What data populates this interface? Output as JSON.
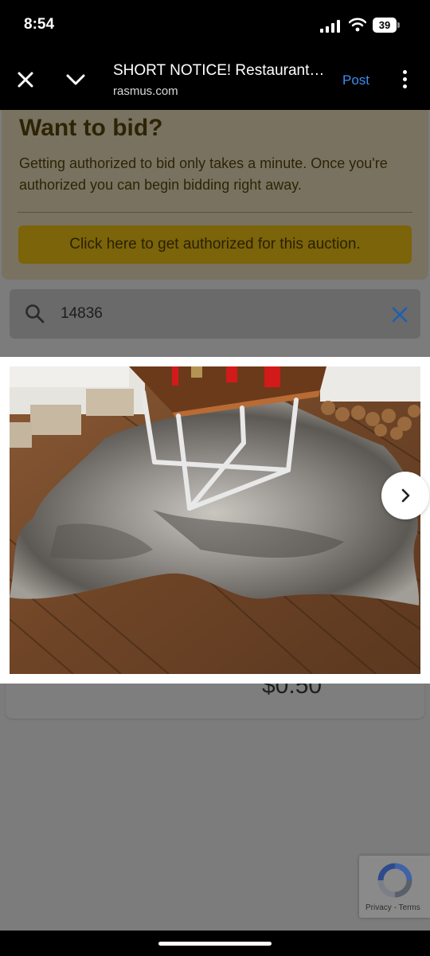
{
  "status": {
    "time": "8:54",
    "battery": "39"
  },
  "browser": {
    "title": "SHORT NOTICE! Restaurant Equipment Auction",
    "domain": "rasmus.com",
    "post_label": "Post"
  },
  "bid_panel": {
    "heading": "Want to bid?",
    "description": "Getting authorized to bid only takes a minute. Once you're authorized you can begin bidding right away.",
    "button_label": "Click here to get authorized for this auction."
  },
  "search": {
    "value": "14836",
    "placeholder": ""
  },
  "item": {
    "price": "$0.50"
  },
  "lightbox": {
    "image_alt": "Gray cowhide rug under a wood and white metal coffee table on a wood plank floor"
  },
  "recaptcha": {
    "privacy": "Privacy",
    "separator": " - ",
    "terms": "Terms"
  },
  "icons": {
    "close": "close-icon",
    "chevron": "chevron-down-icon",
    "more": "more-vertical-icon",
    "search": "search-icon",
    "clear": "clear-icon",
    "next": "chevron-right-icon"
  },
  "colors": {
    "accent": "#3b8ef0",
    "clear_icon": "#1e5fb0",
    "auth_button": "#f2c50e"
  }
}
